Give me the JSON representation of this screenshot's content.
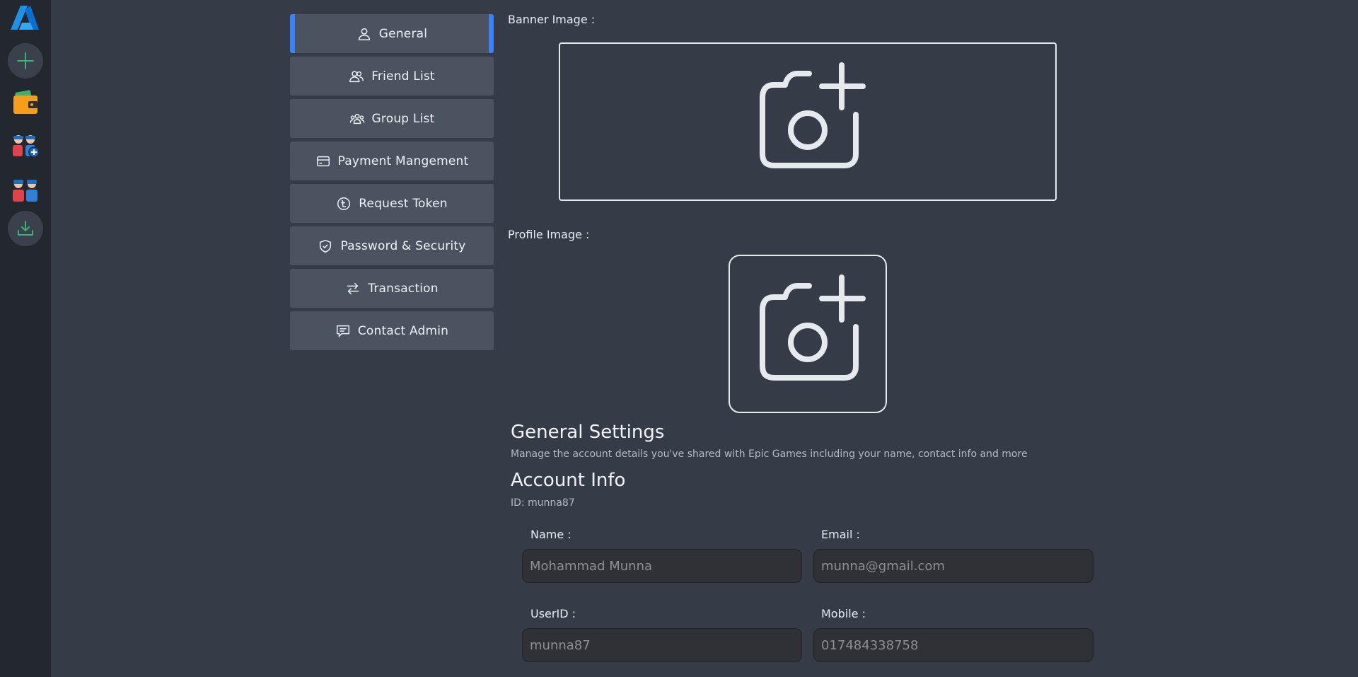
{
  "nav": {
    "items": [
      {
        "label": "General",
        "icon": "user-icon",
        "active": true
      },
      {
        "label": "Friend List",
        "icon": "users-icon",
        "active": false
      },
      {
        "label": "Group List",
        "icon": "group-icon",
        "active": false
      },
      {
        "label": "Payment Mangement",
        "icon": "credit-card-icon",
        "active": false
      },
      {
        "label": "Request Token",
        "icon": "taka-coin-icon",
        "active": false
      },
      {
        "label": "Password & Security",
        "icon": "shield-check-icon",
        "active": false
      },
      {
        "label": "Transaction",
        "icon": "transfer-arrows-icon",
        "active": false
      },
      {
        "label": "Contact Admin",
        "icon": "message-icon",
        "active": false
      }
    ]
  },
  "rail": {
    "icons": [
      "app-logo-icon",
      "add-icon",
      "wallet-icon",
      "add-group-icon",
      "friends-icon",
      "download-icon"
    ]
  },
  "media": {
    "banner_label": "Banner Image :",
    "profile_label": "Profile Image :"
  },
  "general": {
    "title": "General Settings",
    "subtitle": "Manage the account details you've shared with Epic Games including your name, contact info and more"
  },
  "account": {
    "title": "Account Info",
    "id_text": "ID: munna87"
  },
  "form": {
    "name_label": "Name :",
    "name_placeholder": "Mohammad Munna",
    "email_label": "Email :",
    "email_placeholder": "munna@gmail.com",
    "userid_label": "UserID :",
    "userid_placeholder": "munna87",
    "mobile_label": "Mobile :",
    "mobile_placeholder": "017484338758"
  },
  "colors": {
    "accent": "#3b82f6",
    "rail_bg": "#23272e",
    "page_bg": "#363c47",
    "nav_item_bg": "#4b5361"
  }
}
